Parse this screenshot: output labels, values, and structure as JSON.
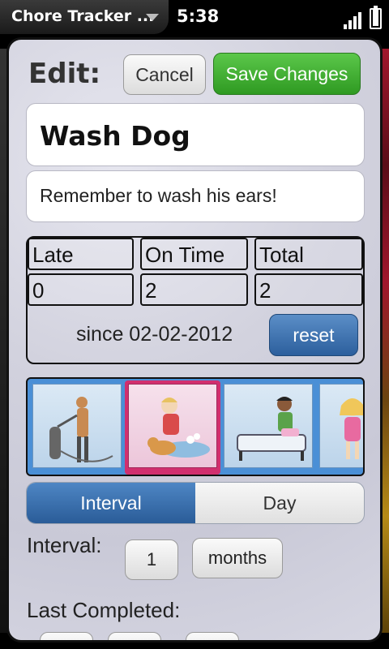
{
  "status_bar": {
    "app_title": "Chore Tracker ...",
    "time": "5:38",
    "battery_level": 0.9
  },
  "header": {
    "edit_label": "Edit:",
    "cancel_label": "Cancel",
    "save_label": "Save Changes"
  },
  "chore": {
    "title": "Wash Dog",
    "note": "Remember to wash his ears!"
  },
  "stats": {
    "headers": [
      "Late",
      "On Time",
      "Total"
    ],
    "values": [
      "0",
      "2",
      "2"
    ],
    "since": "since 02-02-2012",
    "reset_label": "reset"
  },
  "images": {
    "items": [
      "vacuum",
      "wash-dog",
      "make-bed",
      "girl"
    ],
    "selected": "wash-dog"
  },
  "schedule": {
    "tabs": [
      "Interval",
      "Day"
    ],
    "active_tab": "Interval",
    "interval_label": "Interval:",
    "interval_value": "1",
    "interval_unit": "months",
    "last_completed_label": "Last Completed:"
  },
  "colors": {
    "save": "#3aa52b",
    "accent_blue": "#2f63a3",
    "selected_tile": "#d12f6e"
  }
}
